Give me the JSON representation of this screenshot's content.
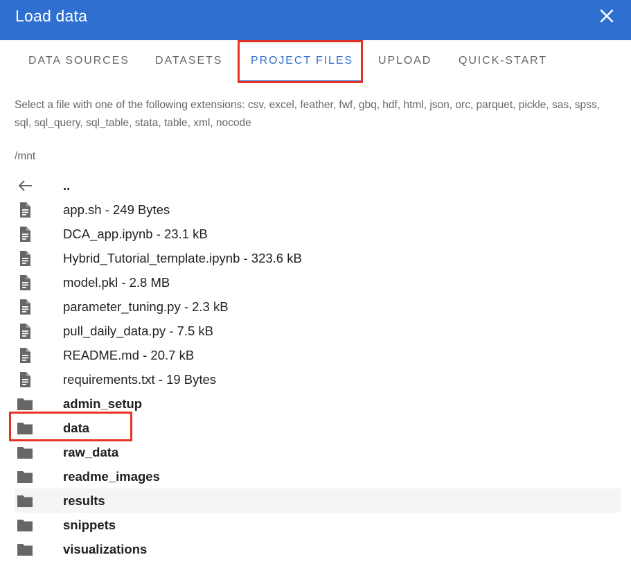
{
  "dialog": {
    "title": "Load data",
    "close_icon": "close-icon",
    "header_color": "#2f6fd0"
  },
  "tabs": [
    {
      "label": "DATA SOURCES",
      "active": false
    },
    {
      "label": "DATASETS",
      "active": false
    },
    {
      "label": "PROJECT FILES",
      "active": true
    },
    {
      "label": "UPLOAD",
      "active": false
    },
    {
      "label": "QUICK-START",
      "active": false
    }
  ],
  "helper_text": "Select a file with one of the following extensions: csv, excel, feather, fwf, gbq, hdf, html, json, orc, parquet, pickle, sas, spss, sql, sql_query, sql_table, stata, table, xml, nocode",
  "current_path": "/mnt",
  "entries": [
    {
      "type": "parent",
      "label": "..",
      "icon": "arrow-left-icon"
    },
    {
      "type": "file",
      "label": "app.sh - 249 Bytes",
      "icon": "file-icon"
    },
    {
      "type": "file",
      "label": "DCA_app.ipynb - 23.1 kB",
      "icon": "file-icon"
    },
    {
      "type": "file",
      "label": "Hybrid_Tutorial_template.ipynb - 323.6 kB",
      "icon": "file-icon"
    },
    {
      "type": "file",
      "label": "model.pkl - 2.8 MB",
      "icon": "file-icon"
    },
    {
      "type": "file",
      "label": "parameter_tuning.py - 2.3 kB",
      "icon": "file-icon"
    },
    {
      "type": "file",
      "label": "pull_daily_data.py - 7.5 kB",
      "icon": "file-icon"
    },
    {
      "type": "file",
      "label": "README.md - 20.7 kB",
      "icon": "file-icon"
    },
    {
      "type": "file",
      "label": "requirements.txt - 19 Bytes",
      "icon": "file-icon"
    },
    {
      "type": "folder",
      "label": "admin_setup",
      "icon": "folder-icon"
    },
    {
      "type": "folder",
      "label": "data",
      "icon": "folder-icon",
      "highlighted": true
    },
    {
      "type": "folder",
      "label": "raw_data",
      "icon": "folder-icon"
    },
    {
      "type": "folder",
      "label": "readme_images",
      "icon": "folder-icon"
    },
    {
      "type": "folder",
      "label": "results",
      "icon": "folder-icon",
      "hovered": true
    },
    {
      "type": "folder",
      "label": "snippets",
      "icon": "folder-icon"
    },
    {
      "type": "folder",
      "label": "visualizations",
      "icon": "folder-icon"
    }
  ],
  "colors": {
    "accent": "#2f6fd0",
    "highlight_box": "#e53323",
    "icon_gray": "#666666"
  }
}
